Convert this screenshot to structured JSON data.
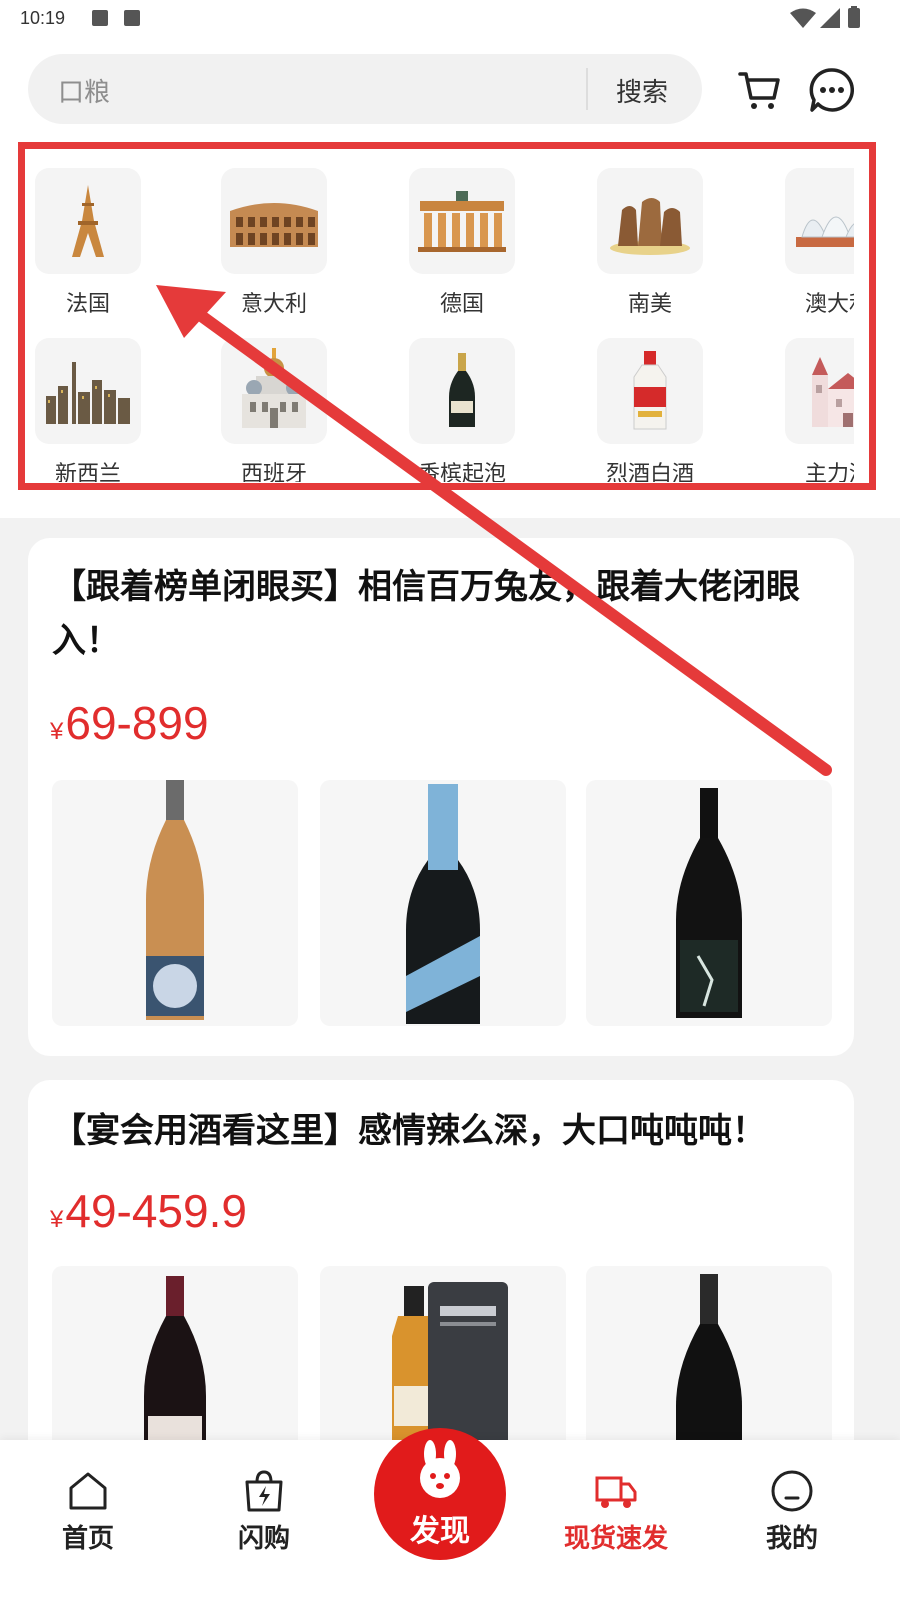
{
  "status_bar": {
    "time": "10:19"
  },
  "search": {
    "placeholder": "口粮",
    "button": "搜索"
  },
  "header_icons": [
    "cart-icon",
    "chat-icon"
  ],
  "categories": [
    {
      "label": "法国",
      "icon": "eiffel-tower-icon"
    },
    {
      "label": "意大利",
      "icon": "colosseum-icon"
    },
    {
      "label": "德国",
      "icon": "brandenburg-gate-icon"
    },
    {
      "label": "南美",
      "icon": "moai-icon"
    },
    {
      "label": "澳大利",
      "icon": "opera-house-icon"
    },
    {
      "label": "新西兰",
      "icon": "city-skyline-icon"
    },
    {
      "label": "西班牙",
      "icon": "cathedral-icon"
    },
    {
      "label": "香槟起泡",
      "icon": "champagne-bottle-icon"
    },
    {
      "label": "烈酒白酒",
      "icon": "baijiu-bottle-icon"
    },
    {
      "label": "主力酒",
      "icon": "castle-icon"
    }
  ],
  "cards": [
    {
      "title": "【跟着榜单闭眼买】相信百万兔友，跟着大佬闭眼入！",
      "currency": "¥",
      "price": "69-899",
      "products": [
        "white-wine-bottle",
        "sparkling-wine-bottle",
        "dark-wine-bottle"
      ]
    },
    {
      "title": "【宴会用酒看这里】感情辣么深，大口吨吨吨！",
      "currency": "¥",
      "price": "49-459.9",
      "products": [
        "red-wine-bottle",
        "whisky-bottle",
        "dark-wine-bottle"
      ]
    }
  ],
  "bottom_nav": {
    "home": "首页",
    "flash": "闪购",
    "discover": "发现",
    "spot": "现货速发",
    "mine": "我的",
    "active": "现货速发"
  },
  "colors": {
    "accent": "#e12d2d",
    "highlight": "#e53a3a"
  }
}
